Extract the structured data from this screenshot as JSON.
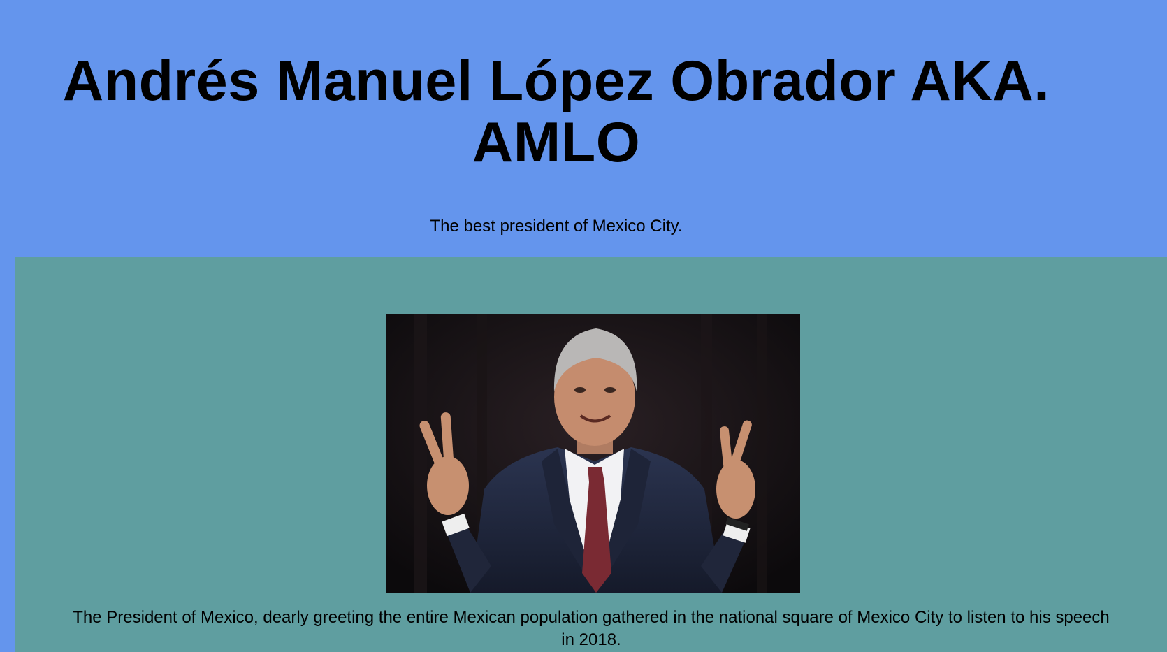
{
  "header": {
    "title": "Andrés Manuel López Obrador AKA. AMLO",
    "tagline": "The best president of Mexico City."
  },
  "main": {
    "photo": {
      "subject": "man in a dark suit and red tie raising both hands in peace signs"
    },
    "caption": "The President of Mexico, dearly greeting the entire Mexican population gathered in the national square of Mexico City to listen to his speech in 2018."
  },
  "colors": {
    "page_background": "#6495ed",
    "main_background": "#5f9ea0",
    "photo_background": "#141214"
  }
}
